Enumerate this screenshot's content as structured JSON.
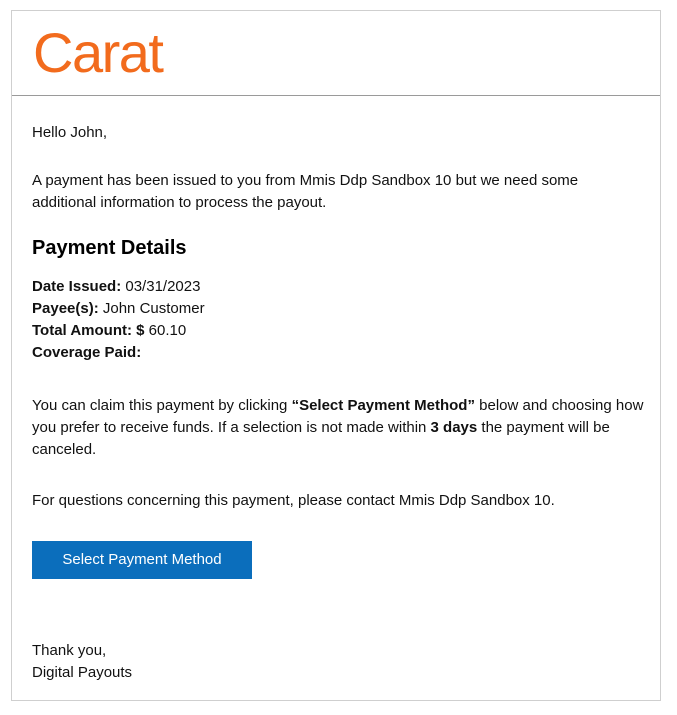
{
  "header": {
    "logo_text": "Carat",
    "logo_color": "#f26b1d"
  },
  "email": {
    "greeting": "Hello John,",
    "intro": "A payment has been issued to you from Mmis Ddp Sandbox 10 but we need some additional information to process the payout.",
    "section_title": "Payment Details",
    "details": {
      "date_issued_label": "Date Issued:",
      "date_issued_value": "03/31/2023",
      "payees_label": "Payee(s):",
      "payees_value": "John Customer",
      "total_amount_label": "Total Amount:",
      "total_amount_currency": "$",
      "total_amount_value": "60.10",
      "coverage_paid_label": "Coverage Paid:",
      "coverage_paid_value": ""
    },
    "claim": {
      "part1": "You can claim this payment by clicking ",
      "button_ref": "“Select Payment Method”",
      "part2": " below and choosing how you prefer to receive funds. If a selection is not made within ",
      "deadline": "3 days",
      "part3": " the payment will be canceled."
    },
    "questions": "For questions concerning this payment, please contact Mmis Ddp Sandbox 10.",
    "cta_label": "Select Payment Method",
    "cta_color": "#0b6ebc",
    "signoff_line1": "Thank you,",
    "signoff_line2": "Digital Payouts"
  }
}
